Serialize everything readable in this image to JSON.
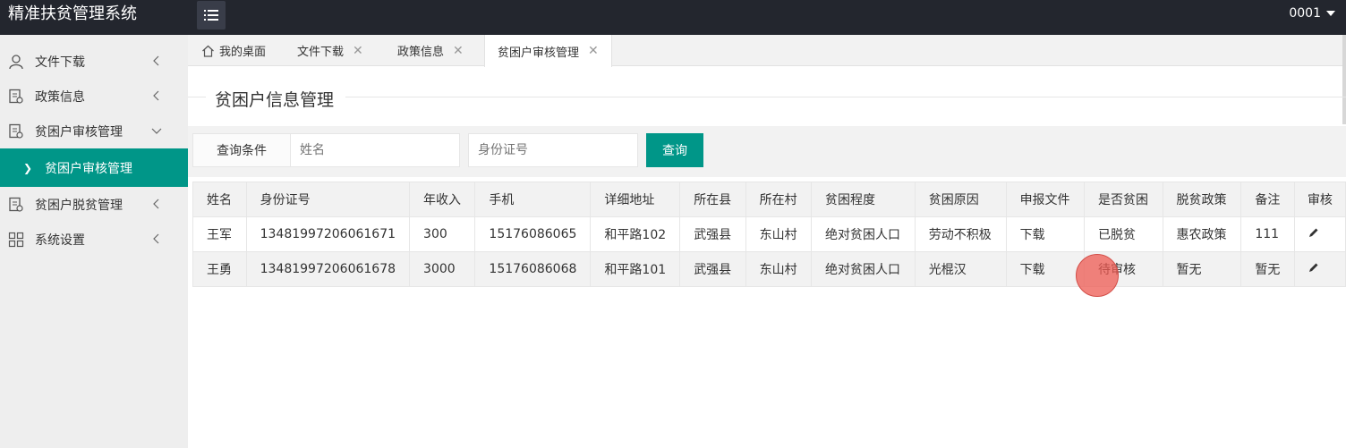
{
  "app": {
    "title": "精准扶贫管理系统",
    "user": "0001"
  },
  "sidebar": {
    "items": [
      {
        "label": "文件下载",
        "icon": "user-icon",
        "arrow": "left"
      },
      {
        "label": "政策信息",
        "icon": "document-icon",
        "arrow": "left"
      },
      {
        "label": "贫困户审核管理",
        "icon": "document-icon",
        "arrow": "down"
      },
      {
        "label": "贫困户脱贫管理",
        "icon": "document-icon",
        "arrow": "left"
      },
      {
        "label": "系统设置",
        "icon": "grid-icon",
        "arrow": "left"
      }
    ],
    "sub_item": {
      "label": "贫困户审核管理"
    }
  },
  "tabs": [
    {
      "label": "我的桌面",
      "icon": "home-icon",
      "closable": false
    },
    {
      "label": "文件下载",
      "closable": true
    },
    {
      "label": "政策信息",
      "closable": true
    },
    {
      "label": "贫困户审核管理",
      "closable": true,
      "active": true
    }
  ],
  "page": {
    "title": "贫困户信息管理"
  },
  "search": {
    "label": "查询条件",
    "name_placeholder": "姓名",
    "id_placeholder": "身份证号",
    "button": "查询"
  },
  "table": {
    "headers": [
      "姓名",
      "身份证号",
      "年收入",
      "手机",
      "详细地址",
      "所在县",
      "所在村",
      "贫困程度",
      "贫困原因",
      "申报文件",
      "是否贫困",
      "脱贫政策",
      "备注",
      "审核"
    ],
    "rows": [
      [
        "王军",
        "13481997206061671",
        "300",
        "15176086065",
        "和平路102",
        "武强县",
        "东山村",
        "绝对贫困人口",
        "劳动不积极",
        "下载",
        "已脱贫",
        "惠农政策",
        "111"
      ],
      [
        "王勇",
        "13481997206061678",
        "3000",
        "15176086068",
        "和平路101",
        "武强县",
        "东山村",
        "绝对贫困人口",
        "光棍汉",
        "下载",
        "待审核",
        "暂无",
        "暂无"
      ]
    ]
  },
  "colors": {
    "topbar": "#23262e",
    "accent": "#009688",
    "sidebar": "#eeeeee"
  }
}
